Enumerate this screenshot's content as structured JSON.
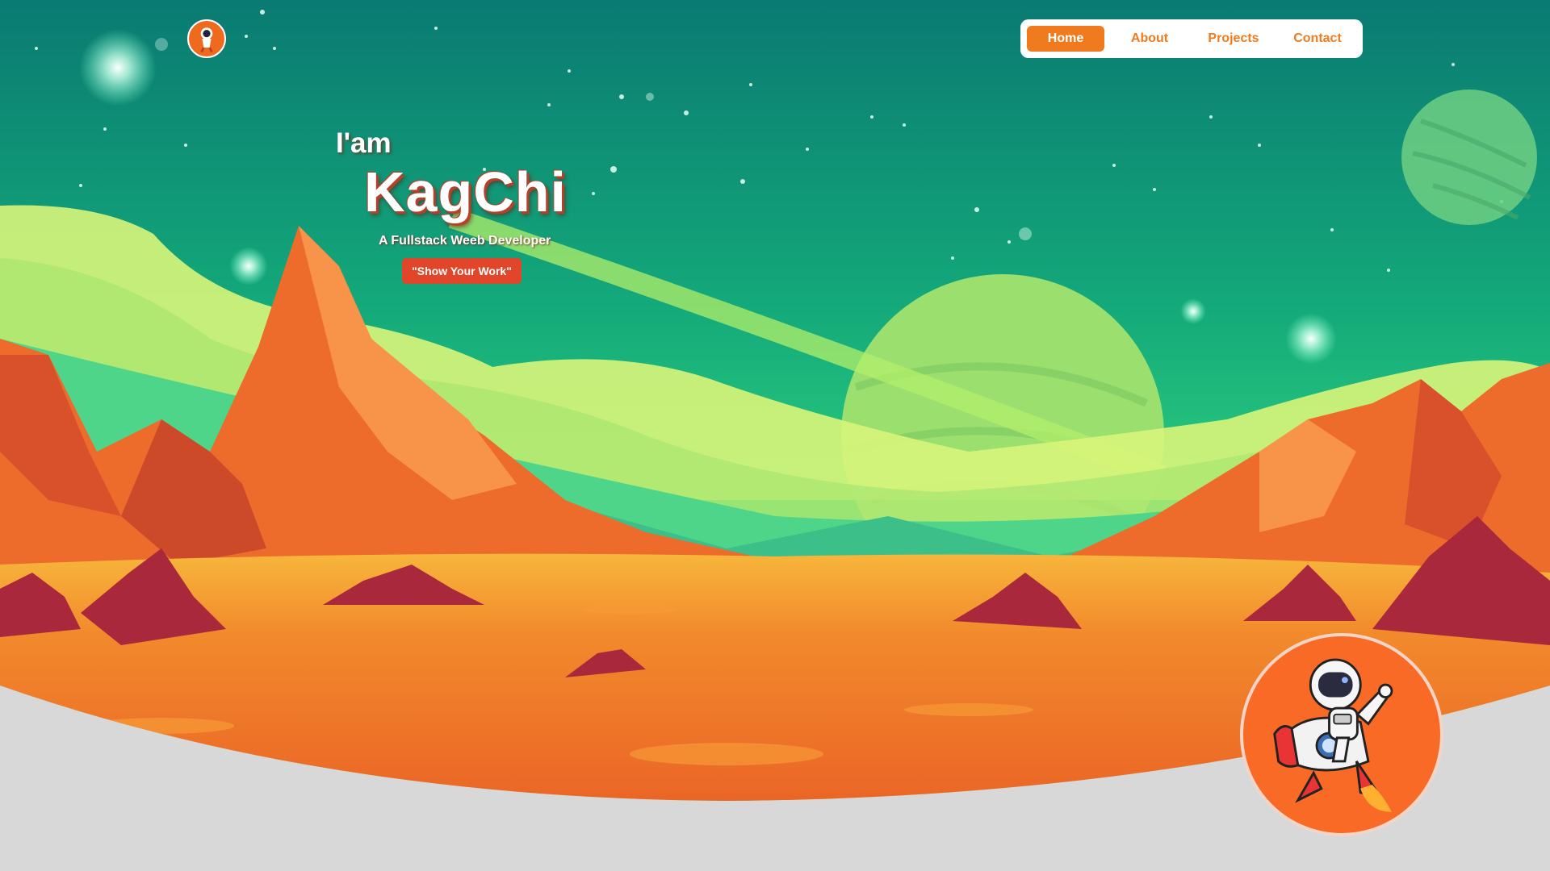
{
  "nav": {
    "items": [
      {
        "label": "Home",
        "active": true
      },
      {
        "label": "About",
        "active": false
      },
      {
        "label": "Projects",
        "active": false
      },
      {
        "label": "Contact",
        "active": false
      }
    ]
  },
  "hero": {
    "greeting": "I'am",
    "name": "KagChi",
    "tagline": "A Fullstack Weeb Developer",
    "cta_label": "\"Show Your Work\""
  },
  "icons": {
    "logo": "astronaut-logo-icon",
    "badge": "astronaut-rocket-illustration"
  },
  "colors": {
    "accent": "#f07a1e",
    "cta": "#e2462a",
    "sky_top": "#0a7a72",
    "sky_bottom": "#2fd17e",
    "ground": "#ee6a23",
    "footer_bg": "#d8d8d8"
  }
}
